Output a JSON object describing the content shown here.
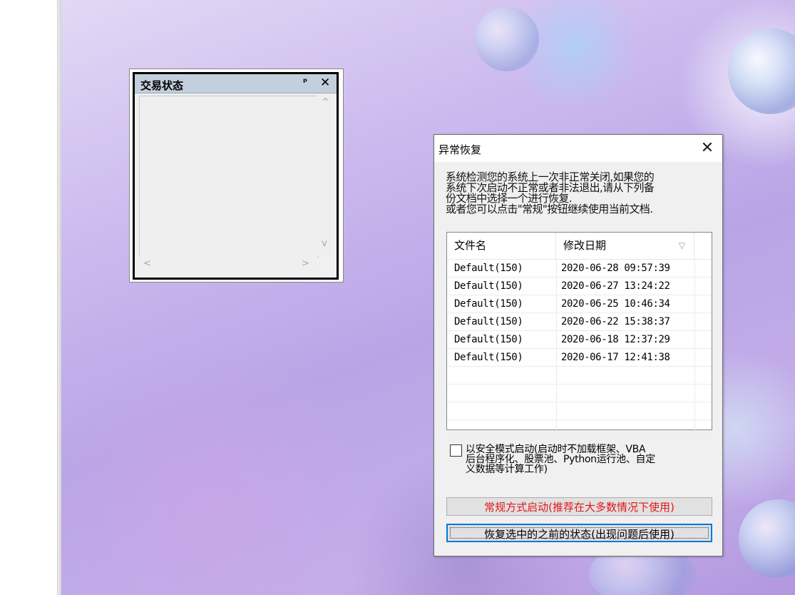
{
  "trade_panel": {
    "title": "交易状态",
    "pin_icon": "ᵖ",
    "close_icon": "✕",
    "scroll_up": "^",
    "scroll_down": "v",
    "scroll_left": "<",
    "scroll_right": ">"
  },
  "dialog": {
    "title": "异常恢复",
    "close_glyph": "✕",
    "message_lines": [
      "系统检测您的系统上一次非正常关闭,如果您的",
      "系统下次启动不正常或者非法退出,请从下列备",
      "份文档中选择一个进行恢复.",
      "或者您可以点击\"常规\"按钮继续使用当前文档."
    ],
    "list": {
      "columns": [
        "文件名",
        "修改日期"
      ],
      "sort_indicator": "▽",
      "rows": [
        {
          "name": "Default(150)",
          "date": "2020-06-28 09:57:39"
        },
        {
          "name": "Default(150)",
          "date": "2020-06-27 13:24:22"
        },
        {
          "name": "Default(150)",
          "date": "2020-06-25 10:46:34"
        },
        {
          "name": "Default(150)",
          "date": "2020-06-22 15:38:37"
        },
        {
          "name": "Default(150)",
          "date": "2020-06-18 12:37:29"
        },
        {
          "name": "Default(150)",
          "date": "2020-06-17 12:41:38"
        },
        {
          "name": "",
          "date": ""
        },
        {
          "name": "",
          "date": ""
        },
        {
          "name": "",
          "date": ""
        },
        {
          "name": "",
          "date": ""
        }
      ]
    },
    "safe_mode_lines": [
      "以安全模式启动(启动时不加载框架、VBA",
      "后台程序化、股票池、Python运行池、自定",
      "义数据等计算工作)"
    ],
    "btn_normal": "常规方式启动(推荐在大多数情况下使用)",
    "btn_restore": "恢复选中的之前的状态(出现问题后使用)",
    "btn_normal_color": "#e21515"
  }
}
